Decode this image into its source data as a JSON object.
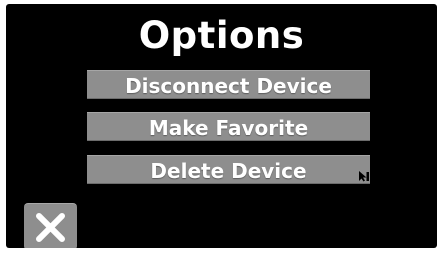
{
  "screen": {
    "title": "Options"
  },
  "menu": {
    "disconnect_label": "Disconnect Device",
    "favorite_label": "Make Favorite",
    "delete_label": "Delete Device"
  },
  "icons": {
    "close": "close-icon",
    "cursor": "pointer-cursor-icon"
  },
  "colors": {
    "background": "#000000",
    "button": "#8e8e8e",
    "text": "#ffffff"
  }
}
